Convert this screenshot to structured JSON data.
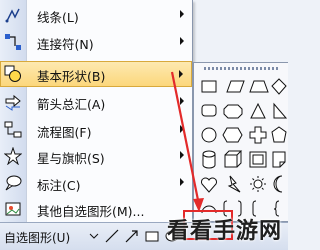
{
  "menu": {
    "items": [
      {
        "label": "线条(L)",
        "icon": "line-icon",
        "has_submenu": true
      },
      {
        "label": "连接符(N)",
        "icon": "connector-icon",
        "has_submenu": true
      },
      {
        "label": "基本形状(B)",
        "icon": "basic-shapes-icon",
        "has_submenu": true
      },
      {
        "label": "箭头总汇(A)",
        "icon": "block-arrows-icon",
        "has_submenu": true
      },
      {
        "label": "流程图(F)",
        "icon": "flowchart-icon",
        "has_submenu": true
      },
      {
        "label": "星与旗帜(S)",
        "icon": "stars-banners-icon",
        "has_submenu": true
      },
      {
        "label": "标注(C)",
        "icon": "callouts-icon",
        "has_submenu": true
      },
      {
        "label": "其他自选图形(M)...",
        "icon": "more-autoshapes-icon",
        "has_submenu": false
      }
    ],
    "active_index": 2
  },
  "statusbar": {
    "autoshape_label": "自选图形(U)"
  },
  "watermark": "看看手游网",
  "colors": {
    "highlight": "#fcd77c",
    "annotation": "#e32a2a"
  }
}
